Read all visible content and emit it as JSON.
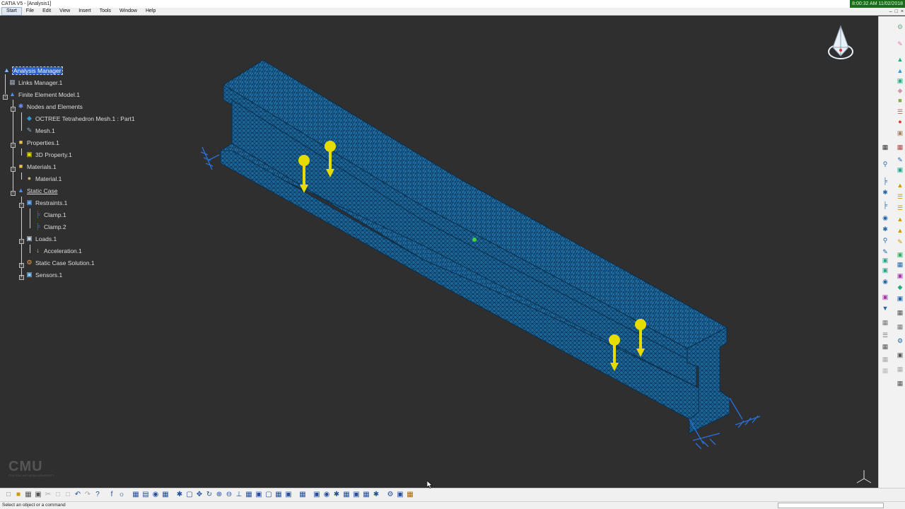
{
  "window": {
    "title": "CATIA V5 - [Analysis1]",
    "clock": "8:00:32 AM 11/02/2018"
  },
  "menu": [
    "Start",
    "File",
    "Edit",
    "View",
    "Insert",
    "Tools",
    "Window",
    "Help"
  ],
  "tree": [
    {
      "label": "Analysis Manager",
      "icon": "analysis-manager-icon",
      "selected": true
    },
    {
      "label": "Links Manager.1",
      "icon": "links-manager-icon"
    },
    {
      "label": "Finite Element Model.1",
      "icon": "fem-icon"
    },
    {
      "label": "Nodes and Elements",
      "icon": "nodes-elements-icon"
    },
    {
      "label": "OCTREE Tetrahedron Mesh.1 : Part1",
      "icon": "mesh-icon"
    },
    {
      "label": "Mesh.1",
      "icon": "mesh-icon"
    },
    {
      "label": "Properties.1",
      "icon": "folder-icon"
    },
    {
      "label": "3D Property.1",
      "icon": "property-icon"
    },
    {
      "label": "Materials.1",
      "icon": "folder-icon"
    },
    {
      "label": "Material.1",
      "icon": "material-icon"
    },
    {
      "label": "Static Case",
      "icon": "static-case-icon"
    },
    {
      "label": "Restraints.1",
      "icon": "restraints-icon"
    },
    {
      "label": "Clamp.1",
      "icon": "clamp-icon"
    },
    {
      "label": "Clamp.2",
      "icon": "clamp-icon"
    },
    {
      "label": "Loads.1",
      "icon": "loads-icon"
    },
    {
      "label": "Acceleration.1",
      "icon": "acceleration-icon"
    },
    {
      "label": "Static Case Solution.1",
      "icon": "solution-icon"
    },
    {
      "label": "Sensors.1",
      "icon": "sensors-icon"
    }
  ],
  "logo": {
    "main": "CMU",
    "sub": "CENTRAL MICHIGAN UNIVERSITY"
  },
  "status": {
    "message": "Select an object or a command"
  },
  "colors": {
    "mesh": "#1f6fa8",
    "load_arrow": "#e6dc00",
    "clamp": "#2a6fd6",
    "background": "#2f2f2f"
  }
}
